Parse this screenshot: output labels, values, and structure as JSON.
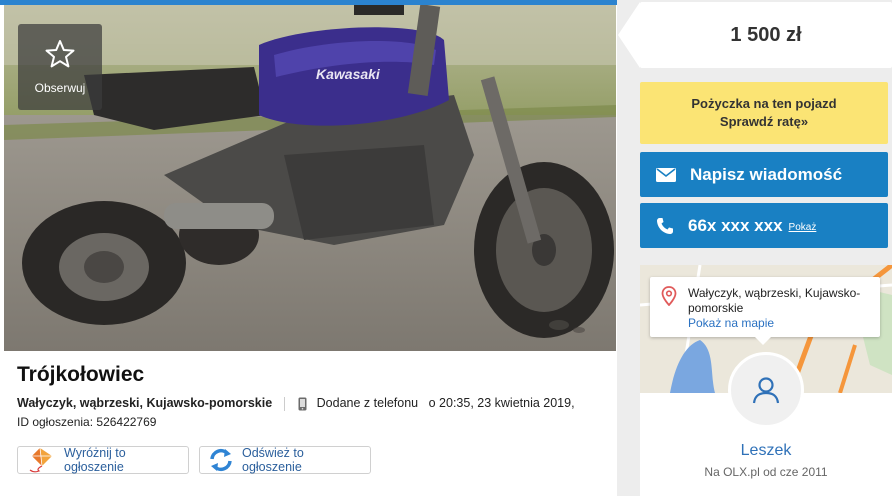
{
  "listing": {
    "observe_label": "Obserwuj",
    "title": "Trójkołowiec",
    "location": "Wałyczyk, wąbrzeski, Kujawsko-pomorskie",
    "added_via": "Dodane z telefonu",
    "added_at": "o 20:35, 23 kwietnia 2019,",
    "ad_id_label": "ID ogłoszenia:",
    "ad_id": "526422769",
    "photo_brand_text": "Kawasaki"
  },
  "actions": {
    "promote_label": "Wyróżnij to ogłoszenie",
    "refresh_label": "Odśwież to ogłoszenie"
  },
  "sidebar": {
    "price": "1 500 zł",
    "loan_line1": "Pożyczka na ten pojazd",
    "loan_line2": "Sprawdź ratę»",
    "message_label": "Napisz wiadomość",
    "phone_masked": "66x xxx xxx",
    "phone_show": "Pokaż"
  },
  "location_card": {
    "address": "Wałyczyk, wąbrzeski, Kujawsko-pomorskie",
    "map_link": "Pokaż na mapie"
  },
  "seller": {
    "name": "Leszek",
    "since": "Na OLX.pl od cze 2011"
  },
  "colors": {
    "accent_blue": "#1980c3",
    "loan_yellow": "#fbe474",
    "link_blue": "#2f71b8"
  }
}
